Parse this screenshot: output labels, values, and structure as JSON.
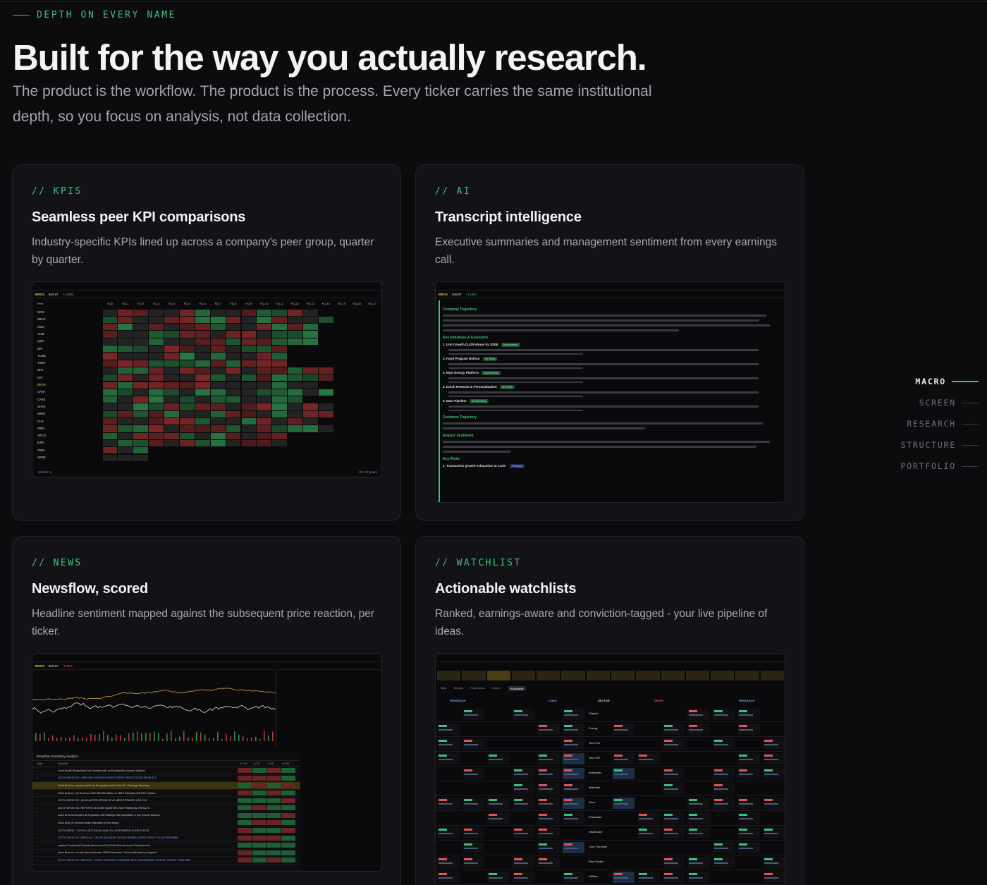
{
  "eyebrow": "DEPTH ON EVERY NAME",
  "hero": {
    "title": "Built for the way you actually research.",
    "subtitle": "The product is the workflow. The product is the process. Every ticker carries the same institutional depth, so you focus on analysis, not data collection."
  },
  "cards": {
    "kpis": {
      "tag": "// KPIS",
      "title": "Seamless peer KPI comparisons",
      "desc": "Industry-specific KPIs lined up across a company's peer group, quarter by quarter.",
      "shot": {
        "ticker": "BROS",
        "price": "$49.87",
        "change": "+1.05%",
        "footer": "Unit Gr %",
        "page": "18 / 17 years",
        "columns": [
          "Peer",
          "FQ0",
          "FQ-1",
          "FQ-2",
          "FQ-3",
          "FQ-4",
          "FQ-5",
          "FQ-6",
          "FQ-7",
          "FQ-8",
          "FQ-9",
          "FQ-10",
          "FQ-11",
          "FQ-12",
          "FQ-13",
          "FQ-14",
          "FQ-15",
          "FQ-16",
          "FQ-17"
        ],
        "peers": [
          "MCD",
          "SBUX",
          "CMG",
          "YUM",
          "QSR",
          "DRI",
          "YUMC",
          "TXRH",
          "DPZ",
          "SAT",
          "BROS",
          "CAVA",
          "CAKE",
          "SHAK",
          "WING",
          "CHA",
          "WEN",
          "ARCO",
          "BJRI",
          "CBRL",
          "ARMK"
        ]
      }
    },
    "ai": {
      "tag": "// AI",
      "title": "Transcript intelligence",
      "desc": "Executive summaries and management sentiment from every earnings call.",
      "shot": {
        "ticker": "BROS",
        "price": "$49.87",
        "change": "+1.05%",
        "sections": [
          "Company Trajectory",
          "Key Initiatives & Execution",
          "Guidance Trajectory",
          "Analyst Sentiment",
          "Key Risks"
        ],
        "initiatives": [
          {
            "label": "1. Unit Growth (2,029 shops by 2029)",
            "status": "Accelerating"
          },
          {
            "label": "2. Food Program Rollout",
            "status": "On Track"
          },
          {
            "label": "3. Mysi Energy Platform",
            "status": "Accelerating"
          },
          {
            "label": "4. Dutch Rewards & Personalization",
            "status": "On Track"
          },
          {
            "label": "5. M&A Pipeline",
            "status": "Accelerating"
          }
        ],
        "risk": {
          "label": "1. Transaction growth exhaustion at scale",
          "status": "emerging"
        }
      }
    },
    "news": {
      "tag": "// NEWS",
      "title": "Newsflow, scored",
      "desc": "Headline sentiment mapped against the subsequent price reaction, per ticker.",
      "shot": {
        "ticker": "BROS",
        "price": "$49.87",
        "change": "-1.05%",
        "panel_title": "Newsflow Sensitivity Analysis",
        "columns": [
          "Date",
          "Headline",
          "T+1%",
          "β 1D",
          "β 5D",
          "β 20D"
        ],
        "headlines": [
          "Dutch Bros® Brings Back Fall Favorites with an Exciting New Autumn Addition",
          "DUTCH BROS INC. <BROS.N>: MIZUHO RAISES TARGET PRICE TO $76 FROM $73",
          "Dutch Bros Inc. reports results for the quarter ended June 30 - Earnings Summary",
          "Dutch Bros Inc. Q2 Revenue USD 550.851 Million vs. IBES Estimate USD 525.4 Million",
          "DUTCH BROS INC. Q2 ADJUSTED EPS $0.26 VS. IBES ESTIMATE USD 0.20",
          "DUTCH BROS INC: REPORTS SECOND QUARTER 2026 FINANCIAL RESULTS",
          "Dutch Bros Accelerates its Expansion with Strategic Site Acquisition in Key Growth Markets",
          "Dutch Bros Q2 revenue beats estimates on new shops",
          "DUTCH BROS - TO ROLL OUT SALAD AND GO LOCATIONS IN FOUR STATES",
          "DUTCH BROS INC <BROS.N>: TRUIST ADVISORY GROUP RAISES TARGET PRICE TO $74 FROM $68",
          "Legacy Commercial Property Announces Two Dutch Bros Anchored Developments",
          "Dutch Bros Inc. to Host Second Quarter 2026 Conference Call and Webcast on August 5",
          "DUTCH BROS INC <BROS.N>: STIFEL INITIATES COVERAGE WITH OVERWEIGHT RATING; TARGET PRICE $90"
        ]
      }
    },
    "watchlist": {
      "tag": "// WATCHLIST",
      "title": "Actionable watchlists",
      "desc": "Ranked, earnings-aware and conviction-tagged - your live pipeline of ideas.",
      "shot": {
        "tabs": [
          "Table",
          "Sectors",
          "Price Action",
          "Screen",
          "Actionable"
        ],
        "group_headers": [
          "RESEARCH",
          "LONG",
          "SECTOR",
          "SHORT",
          "RESEARCH"
        ],
        "sectors": [
          "Staples",
          "Energy",
          "Tech HW",
          "Tech SW",
          "Industrials",
          "Materials",
          "Discr.",
          "Financials",
          "Healthcare",
          "Com. Services",
          "Real Estate",
          "Utilities"
        ]
      }
    }
  },
  "side_nav": [
    "MACRO",
    "SCREEN",
    "RESEARCH",
    "STRUCTURE",
    "PORTFOLIO"
  ],
  "colors": {
    "accent": "#3fbf7f",
    "bg": "#0c0c0f",
    "card": "#131317",
    "pos": "#2f8f4e",
    "neg": "#9a2f2f",
    "gold": "#f0c040"
  }
}
